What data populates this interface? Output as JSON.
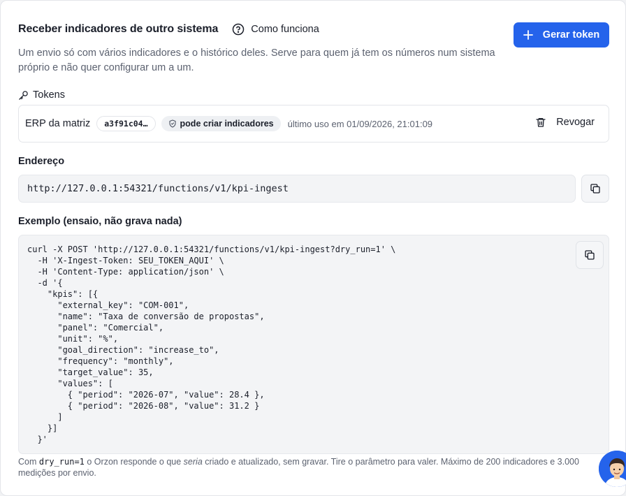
{
  "header": {
    "title": "Receber indicadores de outro sistema",
    "how_label": "Como funciona",
    "generate_label": "Gerar token",
    "description": "Um envio só com vários indicadores e o histórico deles. Serve para quem já tem os números num sistema próprio e não quer configurar um a um."
  },
  "tokens": {
    "label": "Tokens",
    "items": [
      {
        "name": "ERP da matriz",
        "code": "a3f91c04…",
        "permission": "pode criar indicadores",
        "last_use": "último uso em 01/09/2026, 21:01:09",
        "revoke_label": "Revogar"
      }
    ]
  },
  "endpoint": {
    "label": "Endereço",
    "url": "http://127.0.0.1:54321/functions/v1/kpi-ingest"
  },
  "example": {
    "label": "Exemplo (ensaio, não grava nada)",
    "code": "curl -X POST 'http://127.0.0.1:54321/functions/v1/kpi-ingest?dry_run=1' \\\n  -H 'X-Ingest-Token: SEU_TOKEN_AQUI' \\\n  -H 'Content-Type: application/json' \\\n  -d '{\n    \"kpis\": [{\n      \"external_key\": \"COM-001\",\n      \"name\": \"Taxa de conversão de propostas\",\n      \"panel\": \"Comercial\",\n      \"unit\": \"%\",\n      \"goal_direction\": \"increase_to\",\n      \"frequency\": \"monthly\",\n      \"target_value\": 35,\n      \"values\": [\n        { \"period\": \"2026-07\", \"value\": 28.4 },\n        { \"period\": \"2026-08\", \"value\": 31.2 }\n      ]\n    }]\n  }'"
  },
  "footnote": {
    "part1": "Com ",
    "code": "dry_run=1",
    "part2": " o Orzon responde o que ",
    "emphasis": "seria",
    "part3": " criado e atualizado, sem gravar. Tire o parâmetro para valer. Máximo de 200 indicadores e 3.000 medições por envio."
  },
  "colors": {
    "accent": "#2563eb",
    "text": "#1b1f2a",
    "muted": "#5c6270",
    "border": "#e3e5e9",
    "code_bg": "#f3f4f6"
  },
  "icons": {
    "help": "question-circle-icon",
    "plus": "plus-icon",
    "key": "key-icon",
    "shield": "shield-check-icon",
    "trash": "trash-icon",
    "copy": "copy-icon",
    "avatar": "support-avatar"
  }
}
